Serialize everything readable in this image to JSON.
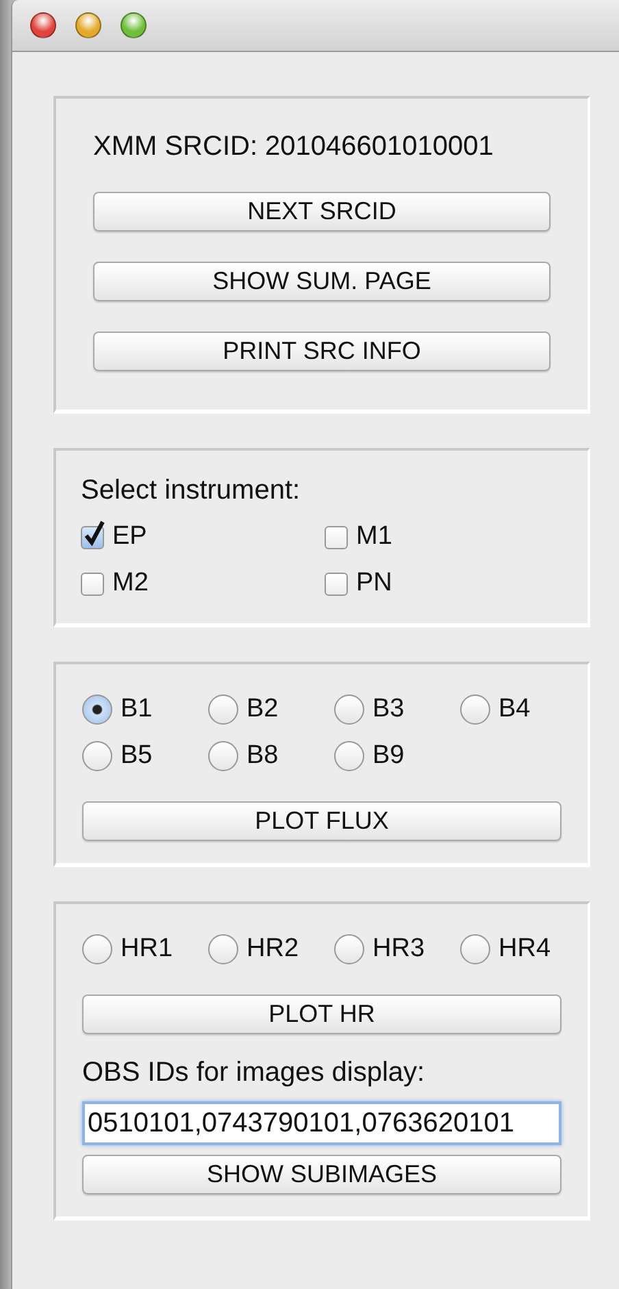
{
  "srcid_label": "XMM SRCID: 201046601010001",
  "source_buttons": [
    "NEXT SRCID",
    "SHOW SUM. PAGE",
    "PRINT SRC INFO"
  ],
  "instrument": {
    "label": "Select instrument:",
    "options": [
      {
        "label": "EP",
        "checked": true
      },
      {
        "label": "M1",
        "checked": false
      },
      {
        "label": "M2",
        "checked": false
      },
      {
        "label": "PN",
        "checked": false
      }
    ]
  },
  "bands": {
    "options": [
      {
        "label": "B1",
        "selected": true
      },
      {
        "label": "B2",
        "selected": false
      },
      {
        "label": "B3",
        "selected": false
      },
      {
        "label": "B4",
        "selected": false
      },
      {
        "label": "B5",
        "selected": false
      },
      {
        "label": "B8",
        "selected": false
      },
      {
        "label": "B9",
        "selected": false
      }
    ],
    "button": "PLOT FLUX"
  },
  "hardness": {
    "options": [
      {
        "label": "HR1",
        "selected": false
      },
      {
        "label": "HR2",
        "selected": false
      },
      {
        "label": "HR3",
        "selected": false
      },
      {
        "label": "HR4",
        "selected": false
      }
    ],
    "button": "PLOT HR"
  },
  "obs_ids": {
    "label": "OBS IDs for images display:",
    "value": "0510101,0743790101,0763620101",
    "button": "SHOW SUBIMAGES"
  }
}
